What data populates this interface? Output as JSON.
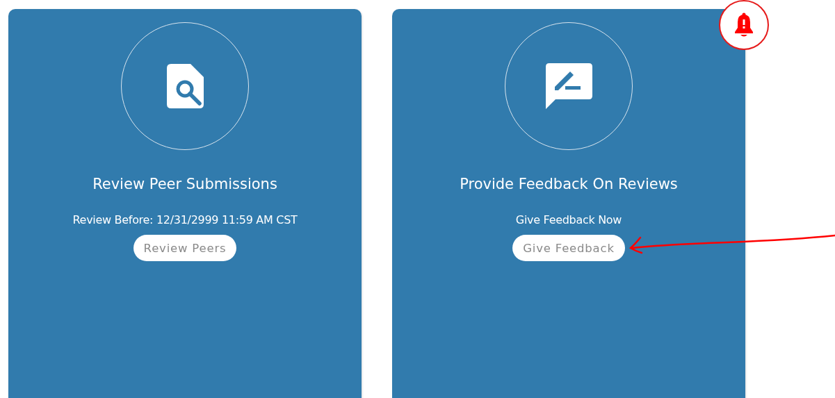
{
  "cards": [
    {
      "kind": "review",
      "title": "Review Peer Submissions",
      "subtitle": "Review Before: 12/31/2999 11:59 AM CST",
      "button": "Review Peers",
      "alert": false
    },
    {
      "kind": "feedback",
      "title": "Provide Feedback On Reviews",
      "subtitle": "Give Feedback Now",
      "button": "Give Feedback",
      "alert": true
    }
  ]
}
